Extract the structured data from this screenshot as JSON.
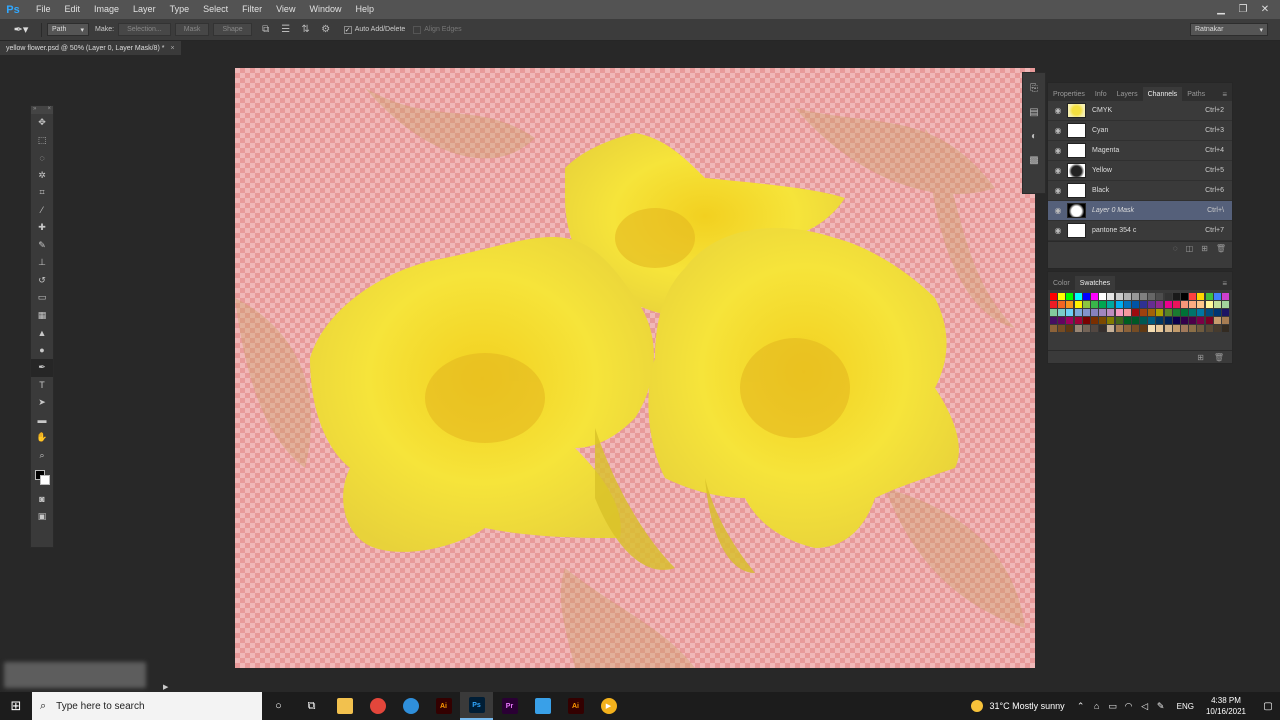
{
  "app": {
    "logo": "Ps"
  },
  "menu": [
    "File",
    "Edit",
    "Image",
    "Layer",
    "Type",
    "Select",
    "Filter",
    "View",
    "Window",
    "Help"
  ],
  "window_controls": {
    "minimize": "▁",
    "restore": "❐",
    "close": "✕"
  },
  "options": {
    "mode_select": "Path",
    "make_label": "Make:",
    "selection_btn": "Selection...",
    "mask_btn": "Mask",
    "shape_btn": "Shape",
    "auto_add_delete": "Auto Add/Delete",
    "align_edges": "Align Edges",
    "workspace": "Ratnakar"
  },
  "document": {
    "tab_title": "yellow flower.psd @ 50% (Layer 0, Layer Mask/8) *"
  },
  "channels_panel": {
    "tabs": [
      "Properties",
      "Info",
      "Layers",
      "Channels",
      "Paths"
    ],
    "active_tab": "Channels",
    "rows": [
      {
        "name": "CMYK",
        "shortcut": "Ctrl+2",
        "thumb": "cmyk"
      },
      {
        "name": "Cyan",
        "shortcut": "Ctrl+3",
        "thumb": "blank"
      },
      {
        "name": "Magenta",
        "shortcut": "Ctrl+4",
        "thumb": "blank"
      },
      {
        "name": "Yellow",
        "shortcut": "Ctrl+5",
        "thumb": "dark"
      },
      {
        "name": "Black",
        "shortcut": "Ctrl+6",
        "thumb": "blank"
      },
      {
        "name": "Layer 0 Mask",
        "shortcut": "Ctrl+\\",
        "thumb": "mask"
      },
      {
        "name": "pantone 354 c",
        "shortcut": "Ctrl+7",
        "thumb": "blank"
      }
    ]
  },
  "swatches_panel": {
    "tabs": [
      "Color",
      "Swatches"
    ],
    "active_tab": "Swatches",
    "colors": [
      "#ff0000",
      "#ffff00",
      "#00ff00",
      "#00ffff",
      "#0000ff",
      "#ff00ff",
      "#ffffff",
      "#e6e6e6",
      "#cccccc",
      "#b3b3b3",
      "#999999",
      "#808080",
      "#666666",
      "#4d4d4d",
      "#333333",
      "#1a1a1a",
      "#000000",
      "#ff4040",
      "#ffd700",
      "#40c040",
      "#4080ff",
      "#d040d0",
      "#ed1c24",
      "#f26522",
      "#f7941d",
      "#fff200",
      "#8dc63f",
      "#39b54a",
      "#00a651",
      "#00a99d",
      "#00aeef",
      "#0072bc",
      "#0054a6",
      "#2e3192",
      "#662d91",
      "#92278f",
      "#ec008c",
      "#ed145b",
      "#f7977a",
      "#fbad82",
      "#fdc68a",
      "#fff799",
      "#c4df9b",
      "#a3d39c",
      "#82ca9c",
      "#7accc8",
      "#6dcff6",
      "#7da7d9",
      "#8393ca",
      "#8781bd",
      "#a186be",
      "#bd8cbf",
      "#f49ac1",
      "#f6989d",
      "#9e0b0f",
      "#a0410d",
      "#a36209",
      "#aba000",
      "#598527",
      "#1a7b30",
      "#007236",
      "#00746b",
      "#0076a3",
      "#004b80",
      "#003471",
      "#1b1464",
      "#440e62",
      "#630460",
      "#9e005d",
      "#9e0039",
      "#790000",
      "#7b2e00",
      "#7d4900",
      "#827b00",
      "#406618",
      "#005e20",
      "#005826",
      "#005952",
      "#005b7f",
      "#003663",
      "#002157",
      "#0d004c",
      "#32004b",
      "#4b0049",
      "#7b0046",
      "#7a0026",
      "#c69c6d",
      "#a67c52",
      "#8c6239",
      "#754c24",
      "#603913",
      "#998675",
      "#736357",
      "#534741",
      "#362f2d",
      "#c7b299",
      "#a67c52",
      "#8c6239",
      "#754c24",
      "#603913",
      "#f5deb3",
      "#e8c99b",
      "#d2b48c",
      "#c19a6b",
      "#a0785a",
      "#8b6f47",
      "#6f5b3e",
      "#594a36",
      "#463b2e",
      "#332b22"
    ]
  },
  "taskbar": {
    "search_placeholder": "Type here to search",
    "apps": [
      {
        "name": "cortana",
        "glyph": "○",
        "color": ""
      },
      {
        "name": "task-view",
        "glyph": "⧉",
        "color": ""
      },
      {
        "name": "file-explorer",
        "glyph": "",
        "color": "#f2c14e"
      },
      {
        "name": "chrome",
        "glyph": "",
        "color": "#e3463b"
      },
      {
        "name": "edge",
        "glyph": "",
        "color": "#2f8fdb"
      },
      {
        "name": "illustrator",
        "glyph": "Ai",
        "color": "#330000"
      },
      {
        "name": "photoshop",
        "glyph": "Ps",
        "color": "#001e36"
      },
      {
        "name": "premiere",
        "glyph": "Pr",
        "color": "#2a0034"
      },
      {
        "name": "notes",
        "glyph": "",
        "color": "#39a0e8"
      },
      {
        "name": "illustrator-2",
        "glyph": "Ai",
        "color": "#330000"
      },
      {
        "name": "media",
        "glyph": "▶",
        "color": "#f3b11c"
      }
    ],
    "weather": "31°C  Mostly sunny",
    "language": "ENG",
    "time": "4:38 PM",
    "date": "10/16/2021"
  },
  "colors": {
    "accent": "#31a8ff",
    "mask_overlay": "#f0b8b8",
    "selected_row": "#55607a",
    "flower": "#f6e43a"
  }
}
